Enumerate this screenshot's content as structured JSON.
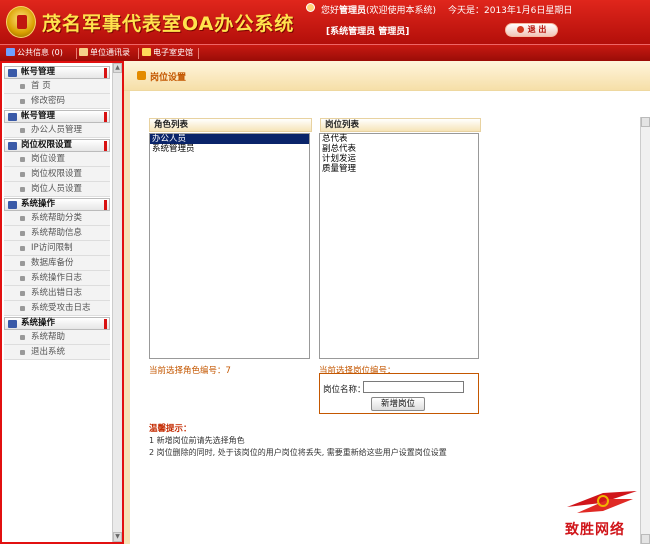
{
  "header": {
    "title": "茂名军事代表室OA办公系统",
    "welcome_prefix": "您好",
    "welcome_user": "管理员",
    "welcome_suffix": "(欢迎使用本系统)",
    "today": "今天是：2013年1月6日星期日",
    "role_line": "[系统管理员 管理员]",
    "logout": "退 出"
  },
  "toolbar": [
    {
      "label": "公共信息 (0)",
      "icon": "info-icon",
      "color": "#6fa0ff"
    },
    {
      "label": "单位通讯录",
      "icon": "contacts-icon",
      "color": "#f5d08a"
    },
    {
      "label": "电子室史馆",
      "icon": "history-icon",
      "color": "#ffd95a"
    }
  ],
  "sidebar": {
    "groups": [
      {
        "title": "帐号管理",
        "items": [
          "首 页",
          "修改密码"
        ]
      },
      {
        "title": "帐号管理",
        "items": [
          "办公人员管理"
        ]
      },
      {
        "title": "岗位权限设置",
        "items": [
          "岗位设置",
          "岗位权限设置",
          "岗位人员设置"
        ]
      },
      {
        "title": "系统操作",
        "items": [
          "系统帮助分类",
          "系统帮助信息",
          "IP访问限制",
          "数据库备份",
          "系统操作日志",
          "系统出错日志",
          "系统受攻击日志"
        ]
      },
      {
        "title": "系统操作",
        "items": [
          "系统帮助",
          "退出系统"
        ]
      }
    ]
  },
  "main": {
    "page_title": "岗位设置",
    "role_list_header": "角色列表",
    "post_list_header": "岗位列表",
    "roles": [
      "办公人员",
      "系统管理员"
    ],
    "selected_role_index": 0,
    "posts": [
      "总代表",
      "副总代表",
      "计划发运",
      "质量管理"
    ],
    "role_selected_note": "当前选择角色编号：7",
    "post_selected_note": "当前选择岗位编号：",
    "post_name_label": "岗位名称：",
    "post_name_value": "",
    "add_button": "新增岗位",
    "tips_title": "温馨提示：",
    "tips": [
      "1  新增岗位前请先选择角色",
      "2  岗位删除的同时, 处于该岗位的用户岗位将丢失, 需要重新给这些用户设置岗位设置"
    ]
  },
  "watermark": {
    "text": "致胜网络"
  }
}
